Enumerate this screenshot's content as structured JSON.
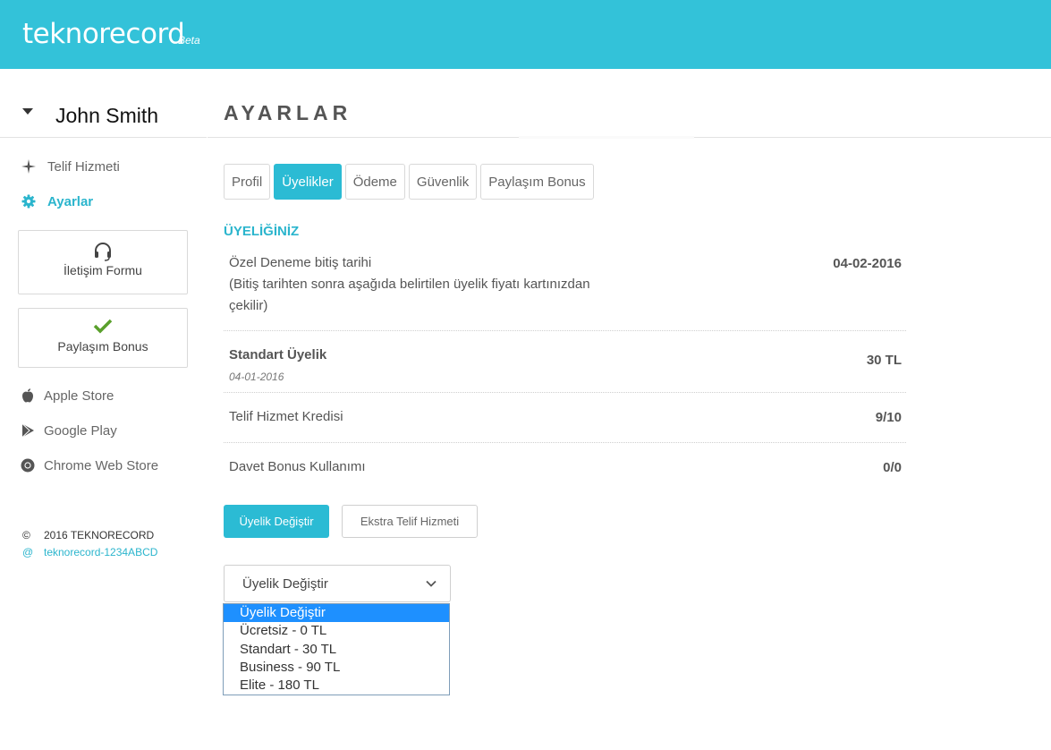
{
  "header": {
    "brand": "teknorecord",
    "brand_tag": "Beta"
  },
  "sidebar": {
    "user_name": "John Smith",
    "nav": [
      {
        "label": "Telif Hizmeti",
        "icon": "plus-cross-icon"
      },
      {
        "label": "Ayarlar",
        "icon": "gear-icon",
        "active": true
      }
    ],
    "cards": [
      {
        "label": "İletişim Formu",
        "icon": "headset-icon"
      },
      {
        "label": "Paylaşım Bonus",
        "icon": "checkmark-icon"
      }
    ],
    "stores": [
      {
        "label": "Apple Store",
        "icon": "apple-icon"
      },
      {
        "label": "Google Play",
        "icon": "play-store-icon"
      },
      {
        "label": "Chrome Web Store",
        "icon": "chrome-icon"
      }
    ],
    "footer": {
      "copyright_symbol": "©",
      "copyright": "2016 TEKNORECORD",
      "at_symbol": "@",
      "link": "teknorecord-1234ABCD"
    }
  },
  "main": {
    "title": "AYARLAR",
    "tabs": [
      {
        "label": "Profil"
      },
      {
        "label": "Üyelikler",
        "active": true
      },
      {
        "label": "Ödeme"
      },
      {
        "label": "Güvenlik"
      },
      {
        "label": "Paylaşım Bonus"
      }
    ],
    "section_title": "ÜYELİĞİNİZ",
    "rows": {
      "trial_label_1": "Özel Deneme bitiş tarihi",
      "trial_label_2": "(Bitiş tarihten sonra aşağıda belirtilen üyelik fiyatı kartınızdan",
      "trial_label_3": "çekilir)",
      "trial_value": "04-02-2016",
      "plan_label": "Standart Üyelik",
      "plan_date": "04-01-2016",
      "plan_value": "30 TL",
      "credit_label": "Telif Hizmet Kredisi",
      "credit_value": "9/10",
      "invite_label": "Davet Bonus Kullanımı",
      "invite_value": "0/0"
    },
    "buttons": {
      "change_plan": "Üyelik Değiştir",
      "extra_service": "Ekstra Telif Hizmeti"
    },
    "plan_select": {
      "value": "Üyelik Değiştir",
      "options": [
        {
          "label": "Üyelik Değiştir",
          "selected": true
        },
        {
          "label": "Ücretsiz - 0 TL"
        },
        {
          "label": "Standart - 30 TL"
        },
        {
          "label": "Business - 90 TL"
        },
        {
          "label": "Elite - 180 TL"
        }
      ]
    }
  },
  "colors": {
    "accent": "#33c2d9",
    "active_text": "#2bb5cd",
    "option_highlight": "#1e90ff"
  }
}
